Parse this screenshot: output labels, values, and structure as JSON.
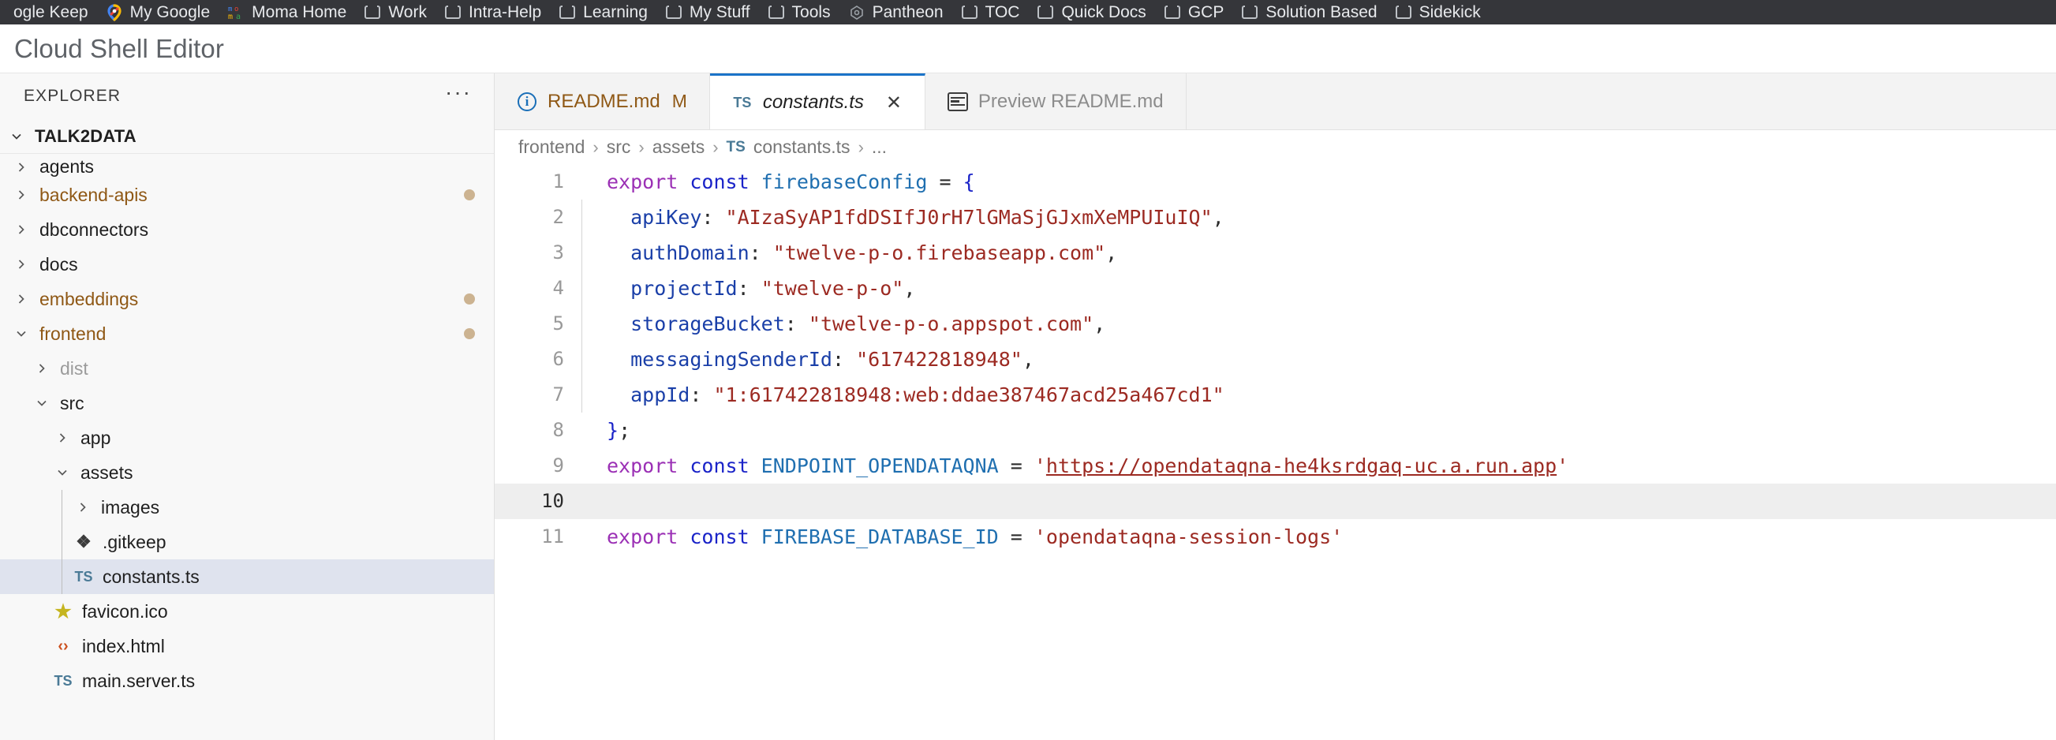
{
  "browser": {
    "bookmarks": [
      {
        "label": "ogle Keep",
        "icon": "none",
        "clipped": true
      },
      {
        "label": "My Google",
        "icon": "google-maps-pin-icon"
      },
      {
        "label": "Moma Home",
        "icon": "moma-icon"
      },
      {
        "label": "Work",
        "icon": "folder-icon"
      },
      {
        "label": "Intra-Help",
        "icon": "folder-icon"
      },
      {
        "label": "Learning",
        "icon": "folder-icon"
      },
      {
        "label": "My Stuff",
        "icon": "folder-icon"
      },
      {
        "label": "Tools",
        "icon": "folder-icon"
      },
      {
        "label": "Pantheon",
        "icon": "pantheon-icon"
      },
      {
        "label": "TOC",
        "icon": "folder-icon"
      },
      {
        "label": "Quick Docs",
        "icon": "folder-icon"
      },
      {
        "label": "GCP",
        "icon": "folder-icon"
      },
      {
        "label": "Solution Based",
        "icon": "folder-icon"
      },
      {
        "label": "Sidekick",
        "icon": "folder-icon"
      }
    ]
  },
  "app": {
    "title": "Cloud Shell Editor"
  },
  "sidebar": {
    "header": "EXPLORER",
    "more_actions": "···",
    "root": "TALK2DATA",
    "tree": [
      {
        "label": "agents",
        "type": "folder",
        "expanded": false,
        "depth": 0,
        "badge": false,
        "clipped": true
      },
      {
        "label": "backend-apis",
        "type": "folder",
        "expanded": false,
        "depth": 0,
        "badge": true,
        "modified": true
      },
      {
        "label": "dbconnectors",
        "type": "folder",
        "expanded": false,
        "depth": 0,
        "badge": false
      },
      {
        "label": "docs",
        "type": "folder",
        "expanded": false,
        "depth": 0,
        "badge": false
      },
      {
        "label": "embeddings",
        "type": "folder",
        "expanded": false,
        "depth": 0,
        "badge": true,
        "modified": true
      },
      {
        "label": "frontend",
        "type": "folder",
        "expanded": true,
        "depth": 0,
        "badge": true,
        "modified": true
      },
      {
        "label": "dist",
        "type": "folder",
        "expanded": false,
        "depth": 1,
        "badge": false,
        "dim": true
      },
      {
        "label": "src",
        "type": "folder",
        "expanded": true,
        "depth": 1,
        "badge": false
      },
      {
        "label": "app",
        "type": "folder",
        "expanded": false,
        "depth": 2,
        "badge": false
      },
      {
        "label": "assets",
        "type": "folder",
        "expanded": true,
        "depth": 2,
        "badge": false
      },
      {
        "label": "images",
        "type": "folder",
        "expanded": false,
        "depth": 3,
        "badge": false
      },
      {
        "label": ".gitkeep",
        "type": "file",
        "icon": "git-icon",
        "depth": 3,
        "badge": false
      },
      {
        "label": "constants.ts",
        "type": "file",
        "icon": "ts-icon",
        "depth": 3,
        "badge": false,
        "selected": true
      },
      {
        "label": "favicon.ico",
        "type": "file",
        "icon": "star-icon",
        "depth": 2,
        "badge": false
      },
      {
        "label": "index.html",
        "type": "file",
        "icon": "html-icon",
        "depth": 2,
        "badge": false
      },
      {
        "label": "main.server.ts",
        "type": "file",
        "icon": "ts-icon",
        "depth": 2,
        "badge": false
      }
    ]
  },
  "editor": {
    "tabs": [
      {
        "label": "README.md",
        "badge": "M",
        "icon": "info-circle-icon",
        "active": false,
        "closable": false,
        "style": "dirty"
      },
      {
        "label": "constants.ts",
        "badge": "",
        "icon": "ts-icon",
        "active": true,
        "closable": true,
        "close": "✕",
        "style": "active"
      },
      {
        "label": "Preview README.md",
        "badge": "",
        "icon": "preview-icon",
        "active": false,
        "closable": false,
        "style": "muted"
      }
    ],
    "breadcrumb": {
      "parts": [
        "frontend",
        "src",
        "assets"
      ],
      "file_icon": "ts-icon",
      "file": "constants.ts",
      "tail": "...",
      "separator": "›"
    },
    "active_line": 10,
    "code": [
      {
        "n": 1,
        "tokens": [
          {
            "t": "export ",
            "c": "k-export"
          },
          {
            "t": "const ",
            "c": "k-const"
          },
          {
            "t": "firebaseConfig ",
            "c": "k-var"
          },
          {
            "t": "= ",
            "c": "k-punc"
          },
          {
            "t": "{",
            "c": "k-brace"
          }
        ],
        "guide": false
      },
      {
        "n": 2,
        "tokens": [
          {
            "t": "  apiKey",
            "c": "k-prop"
          },
          {
            "t": ": ",
            "c": "k-punc"
          },
          {
            "t": "\"AIzaSyAP1fdDSIfJ0rH7lGMaSjGJxmXeMPUIuIQ\"",
            "c": "k-str"
          },
          {
            "t": ",",
            "c": "k-punc"
          }
        ],
        "guide": true
      },
      {
        "n": 3,
        "tokens": [
          {
            "t": "  authDomain",
            "c": "k-prop"
          },
          {
            "t": ": ",
            "c": "k-punc"
          },
          {
            "t": "\"twelve-p-o.firebaseapp.com\"",
            "c": "k-str"
          },
          {
            "t": ",",
            "c": "k-punc"
          }
        ],
        "guide": true
      },
      {
        "n": 4,
        "tokens": [
          {
            "t": "  projectId",
            "c": "k-prop"
          },
          {
            "t": ": ",
            "c": "k-punc"
          },
          {
            "t": "\"twelve-p-o\"",
            "c": "k-str"
          },
          {
            "t": ",",
            "c": "k-punc"
          }
        ],
        "guide": true
      },
      {
        "n": 5,
        "tokens": [
          {
            "t": "  storageBucket",
            "c": "k-prop"
          },
          {
            "t": ": ",
            "c": "k-punc"
          },
          {
            "t": "\"twelve-p-o.appspot.com\"",
            "c": "k-str"
          },
          {
            "t": ",",
            "c": "k-punc"
          }
        ],
        "guide": true
      },
      {
        "n": 6,
        "tokens": [
          {
            "t": "  messagingSenderId",
            "c": "k-prop"
          },
          {
            "t": ": ",
            "c": "k-punc"
          },
          {
            "t": "\"617422818948\"",
            "c": "k-str"
          },
          {
            "t": ",",
            "c": "k-punc"
          }
        ],
        "guide": true
      },
      {
        "n": 7,
        "tokens": [
          {
            "t": "  appId",
            "c": "k-prop"
          },
          {
            "t": ": ",
            "c": "k-punc"
          },
          {
            "t": "\"1:617422818948:web:ddae387467acd25a467cd1\"",
            "c": "k-str"
          }
        ],
        "guide": true
      },
      {
        "n": 8,
        "tokens": [
          {
            "t": "}",
            "c": "k-brace"
          },
          {
            "t": ";",
            "c": "k-punc"
          }
        ],
        "guide": false
      },
      {
        "n": 9,
        "tokens": [
          {
            "t": "export ",
            "c": "k-export"
          },
          {
            "t": "const ",
            "c": "k-const"
          },
          {
            "t": "ENDPOINT_OPENDATAQNA ",
            "c": "k-var"
          },
          {
            "t": "= ",
            "c": "k-punc"
          },
          {
            "t": "'",
            "c": "k-str"
          },
          {
            "t": "https://opendataqna-he4ksrdgaq-uc.a.run.app",
            "c": "k-link"
          },
          {
            "t": "'",
            "c": "k-str"
          }
        ],
        "guide": false
      },
      {
        "n": 10,
        "tokens": [],
        "guide": false
      },
      {
        "n": 11,
        "tokens": [
          {
            "t": "export ",
            "c": "k-export"
          },
          {
            "t": "const ",
            "c": "k-const"
          },
          {
            "t": "FIREBASE_DATABASE_ID ",
            "c": "k-var"
          },
          {
            "t": "= ",
            "c": "k-punc"
          },
          {
            "t": "'opendataqna-session-logs'",
            "c": "k-str"
          }
        ],
        "guide": false
      }
    ]
  },
  "colors": {
    "accent": "#1a73c8",
    "modified": "#8f5815",
    "badge_dot": "#ccb391",
    "string": "#9c2a22",
    "keyword": "#1a23c8",
    "bookmark_bar_bg": "#35363a"
  }
}
